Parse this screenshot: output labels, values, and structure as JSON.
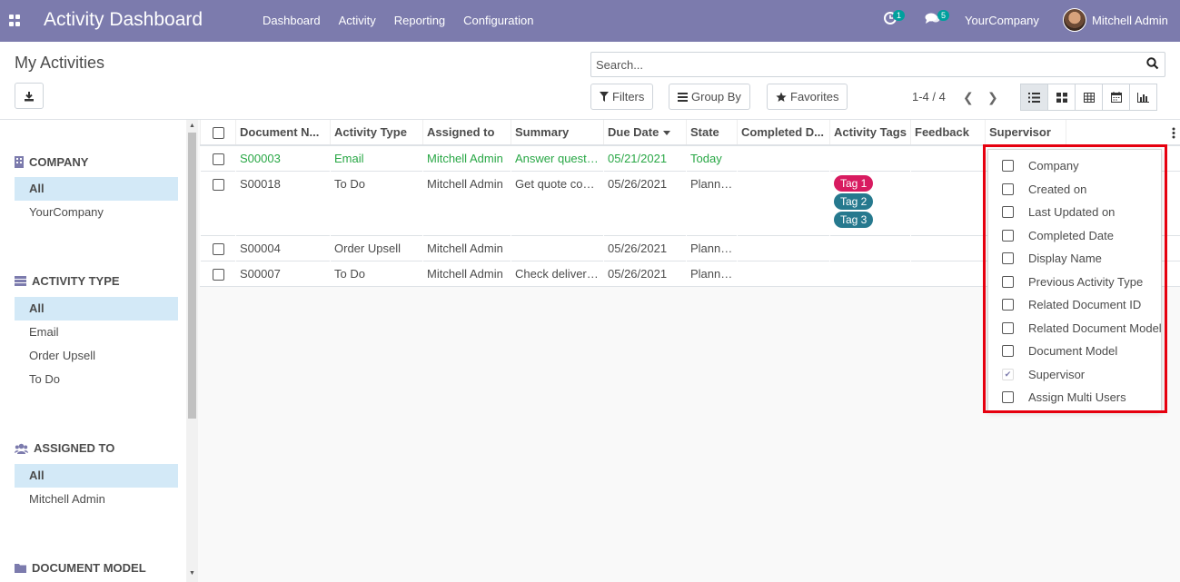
{
  "app": {
    "title": "Activity Dashboard",
    "menu": [
      "Dashboard",
      "Activity",
      "Reporting",
      "Configuration"
    ],
    "activity_badge": "1",
    "messages_badge": "5",
    "company": "YourCompany",
    "user": "Mitchell Admin"
  },
  "control_panel": {
    "breadcrumb": "My Activities",
    "search_placeholder": "Search...",
    "filters_label": "Filters",
    "group_by_label": "Group By",
    "favorites_label": "Favorites",
    "pager": "1-4 / 4"
  },
  "search_panel": {
    "sections": [
      {
        "title": "COMPANY",
        "icon": "building-icon",
        "items": [
          "All",
          "YourCompany"
        ]
      },
      {
        "title": "ACTIVITY TYPE",
        "icon": "list-icon",
        "items": [
          "All",
          "Email",
          "Order Upsell",
          "To Do"
        ]
      },
      {
        "title": "ASSIGNED TO",
        "icon": "users-icon",
        "items": [
          "All",
          "Mitchell Admin"
        ]
      },
      {
        "title": "DOCUMENT MODEL",
        "icon": "folder-icon",
        "items": []
      }
    ]
  },
  "list": {
    "columns": [
      "Document N...",
      "Activity Type",
      "Assigned to",
      "Summary",
      "Due Date",
      "State",
      "Completed D...",
      "Activity Tags",
      "Feedback",
      "Supervisor"
    ],
    "rows": [
      {
        "document": "S00003",
        "activity_type": "Email",
        "assigned_to": "Mitchell Admin",
        "summary": "Answer questi…",
        "due_date": "05/21/2021",
        "state": "Today",
        "tags": []
      },
      {
        "document": "S00018",
        "activity_type": "To Do",
        "assigned_to": "Mitchell Admin",
        "summary": "Get quote con…",
        "due_date": "05/26/2021",
        "state": "Planned",
        "tags": [
          "Tag 1",
          "Tag 2",
          "Tag 3"
        ]
      },
      {
        "document": "S00004",
        "activity_type": "Order Upsell",
        "assigned_to": "Mitchell Admin",
        "summary": "",
        "due_date": "05/26/2021",
        "state": "Planned",
        "tags": []
      },
      {
        "document": "S00007",
        "activity_type": "To Do",
        "assigned_to": "Mitchell Admin",
        "summary": "Check deliver…",
        "due_date": "05/26/2021",
        "state": "Planned",
        "tags": []
      }
    ],
    "tag_colors": {
      "Tag 1": "#d81b60",
      "Tag 2": "#26798e",
      "Tag 3": "#26798e"
    }
  },
  "optional_columns": [
    {
      "label": "Company",
      "checked": false
    },
    {
      "label": "Created on",
      "checked": false
    },
    {
      "label": "Last Updated on",
      "checked": false
    },
    {
      "label": "Completed Date",
      "checked": false
    },
    {
      "label": "Display Name",
      "checked": false
    },
    {
      "label": "Previous Activity Type",
      "checked": false
    },
    {
      "label": "Related Document ID",
      "checked": false
    },
    {
      "label": "Related Document Model",
      "checked": false
    },
    {
      "label": "Document Model",
      "checked": false
    },
    {
      "label": "Supervisor",
      "checked": true
    },
    {
      "label": "Assign Multi Users",
      "checked": false
    }
  ],
  "colors": {
    "navbar": "#7c7bad",
    "today": "#28a745",
    "highlight": "#e6000f",
    "selected_filter": "#d3e9f7"
  }
}
